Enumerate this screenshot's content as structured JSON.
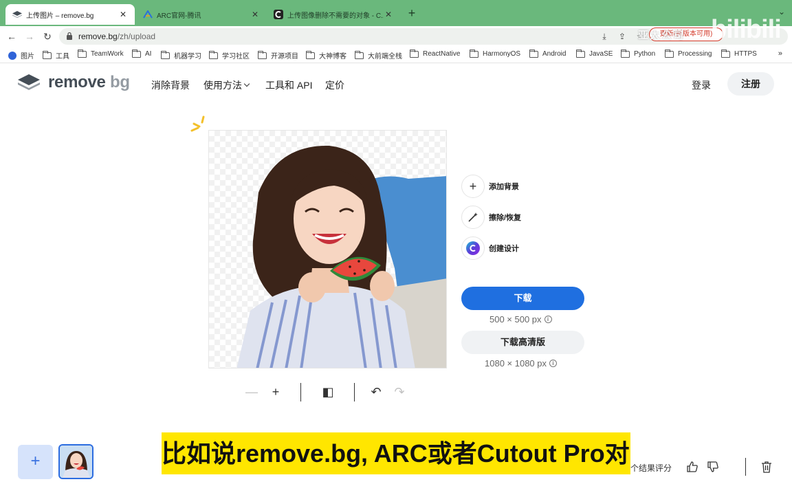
{
  "browser": {
    "tabs": [
      {
        "title": "上传图片 – remove.bg",
        "icon": "removebg-logo-icon"
      },
      {
        "title": "ARC官网-腾讯",
        "icon": "arc-logo-icon"
      },
      {
        "title": "上传图像删除不需要的对象 - C...",
        "icon": "cutout-logo-icon"
      }
    ],
    "new_tab": "+",
    "url_host": "remove.bg",
    "url_path": "/zh/upload",
    "update_label": "更新(新版本可用)",
    "watermark": "亚太公司",
    "bili_mark": "bilibili",
    "bookmarks": [
      "图片",
      "工具",
      "TeamWork",
      "AI",
      "机器学习",
      "学习社区",
      "开源项目",
      "大神博客",
      "大前端全栈",
      "ReactNative",
      "HarmonyOS",
      "Android",
      "JavaSE",
      "Python",
      "Processing",
      "HTTPS"
    ],
    "more": "»"
  },
  "site": {
    "logo_main": "remove",
    "logo_bg": "bg",
    "nav": [
      "消除背景",
      "使用方法",
      "工具和 API",
      "定价"
    ],
    "login": "登录",
    "signup": "注册"
  },
  "editor": {
    "actions": [
      "添加背景",
      "擦除/恢复",
      "创建设计"
    ],
    "download": "下载",
    "download_size": "500 × 500 px",
    "download_hd": "下载高清版",
    "download_hd_size": "1080 × 1080 px",
    "info": "i"
  },
  "toolbar": {
    "zoom_out": "—",
    "zoom_in": "+",
    "compare": "◧",
    "undo": "↶",
    "redo": "↷"
  },
  "bottom": {
    "add": "+",
    "rate_text": "个结果评分"
  },
  "subtitle": "比如说remove.bg, ARC或者Cutout Pro对吧",
  "colors": {
    "tabbar": "#6ab87c",
    "primary": "#1f6fe0",
    "subtitle_bg": "#ffe600"
  }
}
